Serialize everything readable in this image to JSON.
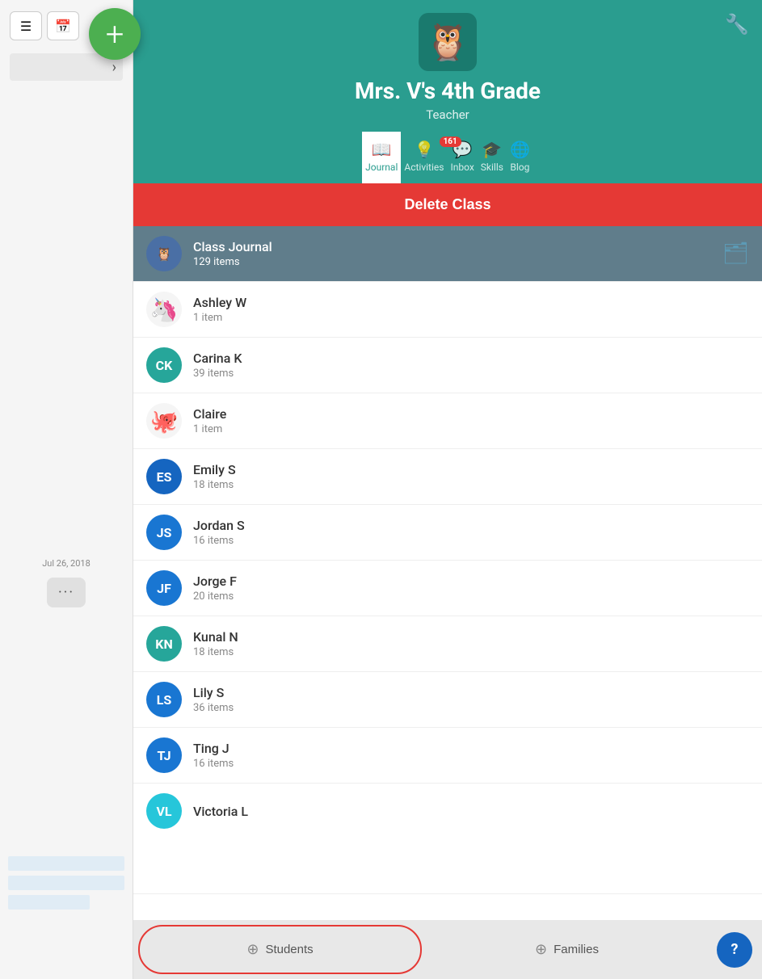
{
  "app": {
    "title": "Mrs. V's 4th Grade",
    "subtitle": "Teacher",
    "wrench_label": "Settings"
  },
  "fab": {
    "label": "+",
    "aria": "Add new"
  },
  "tabs": [
    {
      "id": "journal",
      "label": "Journal",
      "icon": "📖",
      "active": true,
      "badge": null
    },
    {
      "id": "activities",
      "label": "Activities",
      "icon": "💡",
      "active": false,
      "badge": null
    },
    {
      "id": "inbox",
      "label": "Inbox",
      "icon": "💬",
      "active": false,
      "badge": "161"
    },
    {
      "id": "skills",
      "label": "Skills",
      "icon": "🎓",
      "active": false,
      "badge": null
    },
    {
      "id": "blog",
      "label": "Blog",
      "icon": "🌐",
      "active": false,
      "badge": null
    }
  ],
  "delete_class_label": "Delete Class",
  "students": [
    {
      "id": "class-journal",
      "name": "Class Journal",
      "count": "129 items",
      "avatar_type": "owl",
      "avatar_color": "#4a6fa5",
      "initials": ""
    },
    {
      "id": "ashley-w",
      "name": "Ashley W",
      "count": "1 item",
      "avatar_type": "emoji",
      "avatar_color": "#fff",
      "initials": "🦄"
    },
    {
      "id": "carina-k",
      "name": "Carina K",
      "count": "39 items",
      "avatar_type": "initials",
      "avatar_color": "#26a69a",
      "initials": "CK"
    },
    {
      "id": "claire",
      "name": "Claire",
      "count": "1 item",
      "avatar_type": "emoji",
      "avatar_color": "#fff",
      "initials": "🐙"
    },
    {
      "id": "emily-s",
      "name": "Emily S",
      "count": "18 items",
      "avatar_type": "initials",
      "avatar_color": "#1565c0",
      "initials": "ES"
    },
    {
      "id": "jordan-s",
      "name": "Jordan S",
      "count": "16 items",
      "avatar_type": "initials",
      "avatar_color": "#1976d2",
      "initials": "JS"
    },
    {
      "id": "jorge-f",
      "name": "Jorge F",
      "count": "20 items",
      "avatar_type": "initials",
      "avatar_color": "#1976d2",
      "initials": "JF"
    },
    {
      "id": "kunal-n",
      "name": "Kunal N",
      "count": "18 items",
      "avatar_type": "initials",
      "avatar_color": "#26a69a",
      "initials": "KN"
    },
    {
      "id": "lily-s",
      "name": "Lily S",
      "count": "36 items",
      "avatar_type": "initials",
      "avatar_color": "#1976d2",
      "initials": "LS"
    },
    {
      "id": "ting-j",
      "name": "Ting J",
      "count": "16 items",
      "avatar_type": "initials",
      "avatar_color": "#1976d2",
      "initials": "TJ"
    },
    {
      "id": "victoria-l",
      "name": "Victoria L",
      "count": "",
      "avatar_type": "initials",
      "avatar_color": "#26c6da",
      "initials": "VL"
    }
  ],
  "bottom_bar": {
    "students_label": "Students",
    "families_label": "Families",
    "help_label": "?"
  },
  "sidebar": {
    "date": "Jul 26, 2018",
    "more_label": "···"
  }
}
